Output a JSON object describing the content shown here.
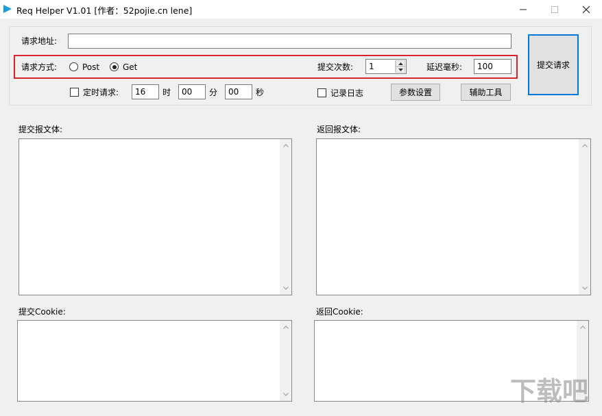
{
  "window": {
    "title": "Req Helper V1.01    [作者：52pojie.cn lene]"
  },
  "url_label": "请求地址:",
  "url_value": "",
  "method_label": "请求方式:",
  "method_options": [
    "Post",
    "Get"
  ],
  "method_selected": "Get",
  "submit_count_label": "提交次数:",
  "submit_count_value": "1",
  "delay_label": "延迟毫秒:",
  "delay_value": "100",
  "timer": {
    "checkbox_label": "定时请求:",
    "checked": false,
    "hour_value": "16",
    "hour_unit": "时",
    "minute_value": "00",
    "minute_unit": "分",
    "second_value": "00",
    "second_unit": "秒"
  },
  "log": {
    "checkbox_label": "记录日志",
    "checked": false
  },
  "buttons": {
    "submit": "提交请求",
    "params": "参数设置",
    "tools": "辅助工具"
  },
  "panels": {
    "submit_body": "提交报文体:",
    "return_body": "返回报文体:",
    "submit_cookie": "提交Cookie:",
    "return_cookie": "返回Cookie:"
  },
  "watermark": {
    "text": "下载吧"
  },
  "colors": {
    "accent": "#0078d7",
    "highlight": "#d9232e",
    "icon": "#1a9be0"
  },
  "icons": [
    "app-icon",
    "minimize-icon",
    "maximize-icon",
    "close-icon",
    "spin-up-icon",
    "spin-down-icon",
    "scroll-up-icon",
    "scroll-down-icon"
  ]
}
